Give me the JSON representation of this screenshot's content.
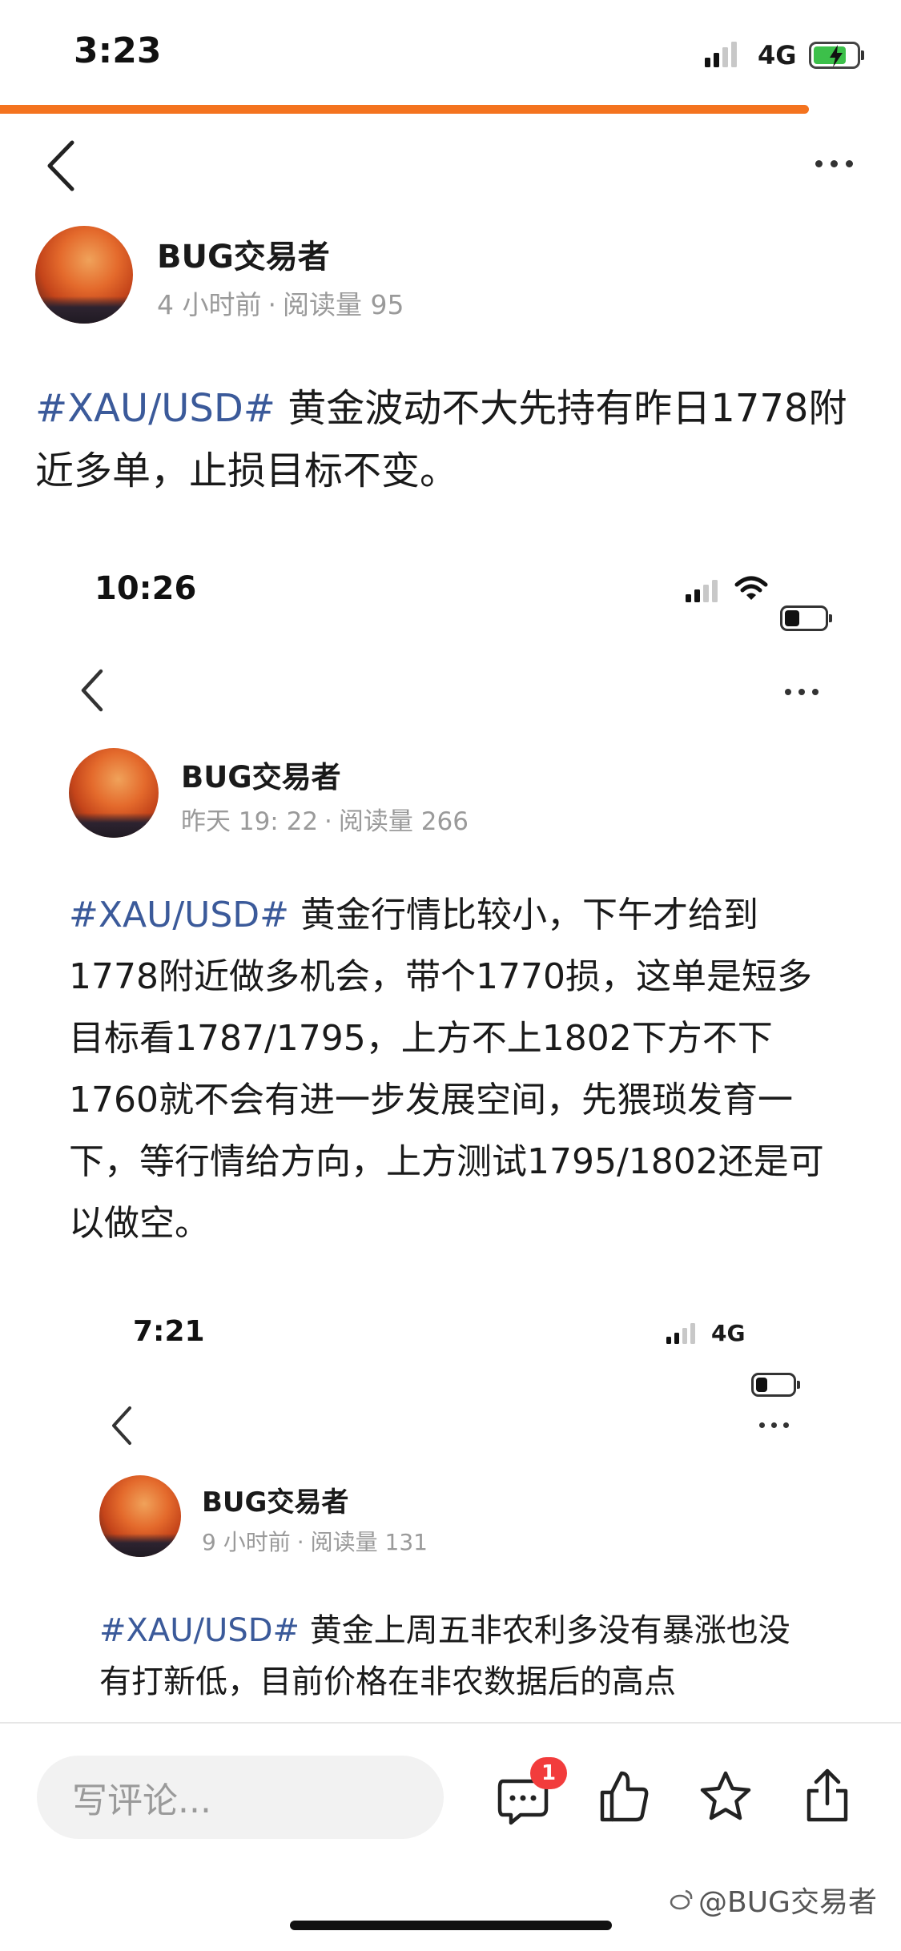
{
  "status_bar": {
    "time": "3:23",
    "network": "4G"
  },
  "header": {},
  "post": {
    "author": "BUG交易者",
    "time": "4 小时前",
    "reads": "阅读量 95",
    "tag": "#XAU/USD#",
    "text": " 黄金波动不大先持有昨日1778附近多单，止损目标不变。"
  },
  "embedded_1": {
    "status_time": "10:26",
    "author": "BUG交易者",
    "time": "昨天 19: 22",
    "reads": "阅读量 266",
    "tag": "#XAU/USD#",
    "text": " 黄金行情比较小，下午才给到1778附近做多机会，带个1770损，这单是短多目标看1787/1795，上方不上1802下方不下1760就不会有进一步发展空间，先猥琐发育一下，等行情给方向，上方测试1795/1802还是可以做空。"
  },
  "embedded_2": {
    "status_time": "7:21",
    "network": "4G",
    "author": "BUG交易者",
    "time": "9 小时前",
    "reads": "阅读量 131",
    "tag": "#XAU/USD#",
    "text": " 黄金上周五非农利多没有暴涨也没有打新低，目前价格在非农数据后的高点"
  },
  "bottom_bar": {
    "comment_placeholder": "写评论...",
    "comment_count": "1"
  },
  "watermark": "@BUG交易者",
  "colors": {
    "accent": "#f4731f",
    "tag": "#3b5a9a",
    "badge": "#f23c3c"
  }
}
